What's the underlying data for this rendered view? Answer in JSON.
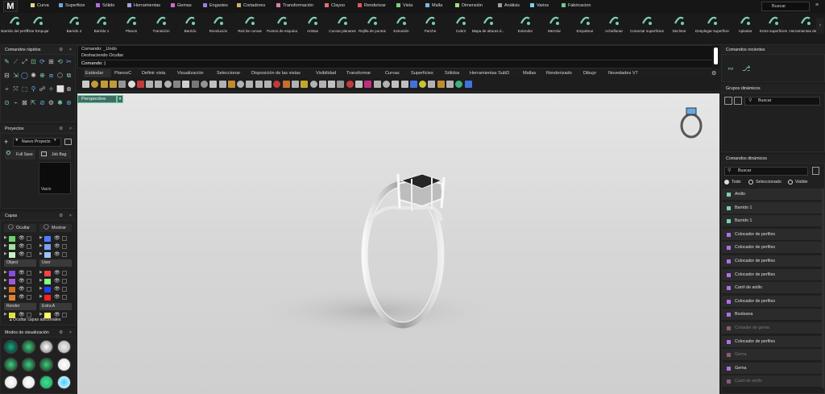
{
  "logo": "M",
  "menu": [
    {
      "label": "Curva",
      "color": "#e8d48a"
    },
    {
      "label": "Superficie",
      "color": "#6aa8e0"
    },
    {
      "label": "Sólido",
      "color": "#b46be0"
    },
    {
      "label": "Herramientas",
      "color": "#9aa2e8"
    },
    {
      "label": "Gemas",
      "color": "#d06bc8"
    },
    {
      "label": "Engastes",
      "color": "#9e7de0"
    },
    {
      "label": "Cortadores",
      "color": "#d4b06a"
    },
    {
      "label": "Transformación",
      "color": "#e07ab0"
    },
    {
      "label": "Clayoo",
      "color": "#e07070"
    },
    {
      "label": "Renderizar",
      "color": "#e05a5a"
    },
    {
      "label": "Vista",
      "color": "#7ad07a"
    },
    {
      "label": "Malla",
      "color": "#7ab8e0"
    },
    {
      "label": "Dimensión",
      "color": "#9de07a"
    },
    {
      "label": "Análisis",
      "color": "#a0a0a0"
    },
    {
      "label": "Varios",
      "color": "#7ad0e8"
    },
    {
      "label": "Fabricacion",
      "color": "#70c890"
    }
  ],
  "search": {
    "placeholder": "Buscar"
  },
  "ribbon": [
    "Barrido del perfil",
    "Tirar Empujar",
    "Barrido 2",
    "Barrido 1",
    "Planos",
    "Transición",
    "Barrido",
    "Revolución",
    "Red de curvas",
    "Puntos de esquina",
    "Aristas",
    "Curvas planares",
    "Rejilla de puntos",
    "Extrusión",
    "Parche",
    "Cubrir",
    "Mapa de alturas d...",
    "Extender",
    "Mezclar",
    "Empalmar",
    "Achaflanar",
    "Conectar superficies",
    "Declinar",
    "Desplegar superficie",
    "Aplastar",
    "Entre superficies",
    "Herramientas de s..."
  ],
  "quick": {
    "title": "Comandos rápidos"
  },
  "projects": {
    "title": "Proyectos",
    "dropdown": "Nuevo Proyecto",
    "full_save": "Full Save",
    "job_bag": "Job Bag",
    "thumb_label": "Vacío"
  },
  "layers": {
    "title": "Capas",
    "hide": "Ocultar",
    "show": "Mostrar",
    "object": "Object",
    "user": "User",
    "render": "Render",
    "extra": "Extra A",
    "more": "Ocultar capas adicionales"
  },
  "modes": {
    "title": "Modos de visualización"
  },
  "command": {
    "line1": "Comando: _Undo",
    "line2": "Deshaciendo Ocultar",
    "prompt": "Comando:"
  },
  "tabs": [
    "Estándar",
    "PlanosC",
    "Definir vista",
    "Visualización",
    "Seleccionar",
    "Disposición de las vistas",
    "Visibilidad",
    "Transformar",
    "Curvas",
    "Superficies",
    "Sólidos",
    "Herramientas SubD",
    "Mallas",
    "Renderizado",
    "Dibujo",
    "Novedades V7"
  ],
  "viewport": {
    "label": "Perspective"
  },
  "recent": {
    "title": "Comandos recientes"
  },
  "groups": {
    "title": "Grupos dinámicos",
    "search": "Buscar"
  },
  "dyn": {
    "title": "Comandos dinámicos",
    "search": "Buscar",
    "opt_all": "Todo",
    "opt_sel": "Seleccionado",
    "opt_vis": "Visible",
    "items": [
      {
        "label": "Anillo",
        "color": "#7ad0b0",
        "dim": false
      },
      {
        "label": "Barrido 1",
        "color": "#7ad0b0",
        "dim": false
      },
      {
        "label": "Barrido 1",
        "color": "#7ad0b0",
        "dim": false
      },
      {
        "label": "Colocador de perfiles",
        "color": "#b070e8",
        "dim": false
      },
      {
        "label": "Colocador de perfiles",
        "color": "#b070e8",
        "dim": false
      },
      {
        "label": "Colocador de perfiles",
        "color": "#b070e8",
        "dim": false
      },
      {
        "label": "Colocador de perfiles",
        "color": "#b070e8",
        "dim": false
      },
      {
        "label": "Carril de anillo",
        "color": "#b070e8",
        "dim": false
      },
      {
        "label": "Colocador de perfiles",
        "color": "#b070e8",
        "dim": false
      },
      {
        "label": "Booleana",
        "color": "#b070e8",
        "dim": false
      },
      {
        "label": "Cortador de gema",
        "color": "#8a5a7a",
        "dim": true
      },
      {
        "label": "Colocador de perfiles",
        "color": "#b070e8",
        "dim": false
      },
      {
        "label": "Gema",
        "color": "#8a5a7a",
        "dim": true
      },
      {
        "label": "Gema",
        "color": "#b070e8",
        "dim": false
      },
      {
        "label": "Carril de anillo",
        "color": "#8a5a7a",
        "dim": true
      }
    ]
  }
}
